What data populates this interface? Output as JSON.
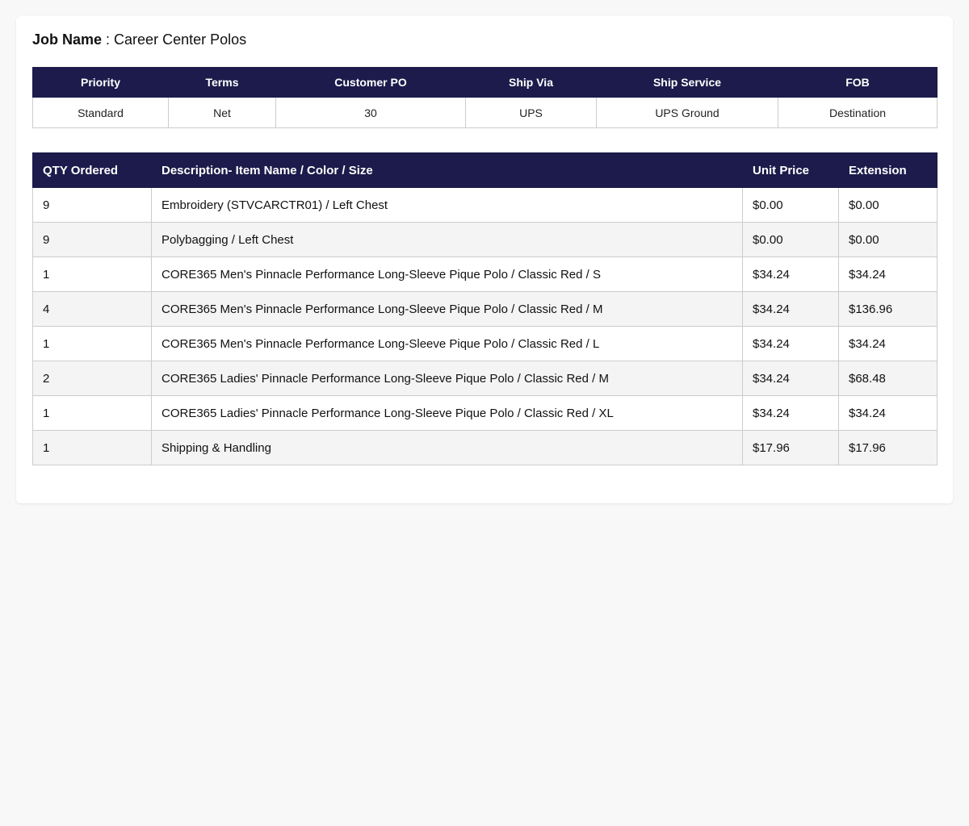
{
  "job": {
    "label": "Job Name",
    "separator": " : ",
    "value": "Career Center Polos"
  },
  "meta": {
    "headers": [
      "Priority",
      "Terms",
      "Customer PO",
      "Ship Via",
      "Ship Service",
      "FOB"
    ],
    "values": [
      "Standard",
      "Net",
      "30",
      "UPS",
      "UPS Ground",
      "Destination"
    ]
  },
  "items": {
    "headers": [
      "QTY Ordered",
      "Description- Item Name / Color / Size",
      "Unit Price",
      "Extension"
    ],
    "rows": [
      {
        "qty": "9",
        "description": "Embroidery (STVCARCTR01) / Left Chest",
        "unit_price": "$0.00",
        "extension": "$0.00"
      },
      {
        "qty": "9",
        "description": "Polybagging / Left Chest",
        "unit_price": "$0.00",
        "extension": "$0.00"
      },
      {
        "qty": "1",
        "description": "CORE365 Men's Pinnacle Performance Long-Sleeve Pique Polo / Classic Red / S",
        "unit_price": "$34.24",
        "extension": "$34.24"
      },
      {
        "qty": "4",
        "description": "CORE365 Men's Pinnacle Performance Long-Sleeve Pique Polo / Classic Red / M",
        "unit_price": "$34.24",
        "extension": "$136.96"
      },
      {
        "qty": "1",
        "description": "CORE365 Men's Pinnacle Performance Long-Sleeve Pique Polo / Classic Red / L",
        "unit_price": "$34.24",
        "extension": "$34.24"
      },
      {
        "qty": "2",
        "description": "CORE365 Ladies' Pinnacle Performance Long-Sleeve Pique Polo / Classic Red / M",
        "unit_price": "$34.24",
        "extension": "$68.48"
      },
      {
        "qty": "1",
        "description": "CORE365 Ladies' Pinnacle Performance Long-Sleeve Pique Polo / Classic Red / XL",
        "unit_price": "$34.24",
        "extension": "$34.24"
      },
      {
        "qty": "1",
        "description": "Shipping & Handling",
        "unit_price": "$17.96",
        "extension": "$17.96"
      }
    ]
  },
  "colors": {
    "header_bg": "#1c1b4b",
    "header_text": "#ffffff",
    "alt_row_bg": "#f4f4f4"
  }
}
